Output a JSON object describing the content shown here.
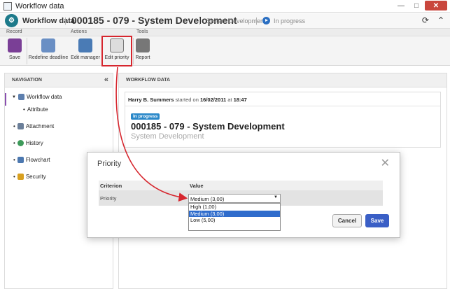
{
  "window": {
    "title": "Workflow data"
  },
  "header": {
    "app_label": "Workflow data",
    "document": "000185 - 079 - System Development",
    "subject": "System Development",
    "status": "In progress"
  },
  "toolbar": {
    "groups": [
      "Record",
      "Actions",
      "Tools"
    ],
    "buttons": [
      "Save",
      "Redefine deadline",
      "Edit manager",
      "Edit priority",
      "Report"
    ]
  },
  "navigation": {
    "title": "NAVIGATION",
    "items": [
      "Workflow data",
      "Attribute",
      "Attachment",
      "History",
      "Flowchart",
      "Security"
    ]
  },
  "workflow": {
    "title": "WORKFLOW DATA",
    "starter": "Harry B. Summers",
    "started_on_text": "started on",
    "date": "16/02/2011",
    "at_text": "at",
    "time": "18:47",
    "badge": "In progress",
    "heading": "000185 - 079 - System Development",
    "subheading": "System Development"
  },
  "dialog": {
    "title": "Priority",
    "col_criterion": "Criterion",
    "col_value": "Value",
    "row_label": "Priority",
    "selected_value": "Medium (3,00)",
    "options": [
      "High (1,00)",
      "Medium (3,00)",
      "Low (5,00)"
    ],
    "cancel_label": "Cancel",
    "save_label": "Save"
  },
  "colors": {
    "accent": "#3a5fc6",
    "annotation": "#d6262e",
    "brand": "#1d7a8a"
  }
}
